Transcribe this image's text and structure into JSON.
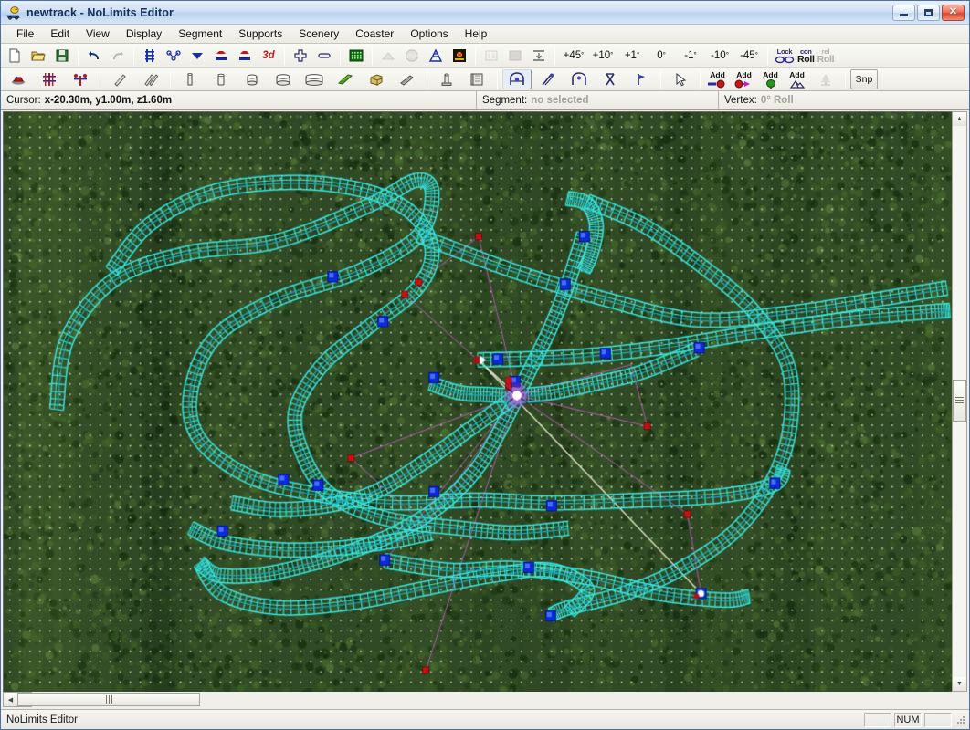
{
  "window": {
    "title": "newtrack - NoLimits Editor",
    "app_icon": "coaster-car-icon",
    "controls": {
      "minimize": "minimize-button",
      "maximize": "maximize-button",
      "close": "close-button"
    }
  },
  "menu": {
    "items": [
      {
        "label": "File"
      },
      {
        "label": "Edit"
      },
      {
        "label": "View"
      },
      {
        "label": "Display"
      },
      {
        "label": "Segment"
      },
      {
        "label": "Supports"
      },
      {
        "label": "Scenery"
      },
      {
        "label": "Coaster"
      },
      {
        "label": "Options"
      },
      {
        "label": "Help"
      }
    ]
  },
  "toolbar_row1": {
    "groups": [
      {
        "buttons": [
          {
            "name": "new-file-button",
            "icon": "new-document-icon",
            "label": ""
          },
          {
            "name": "open-file-button",
            "icon": "open-folder-icon",
            "label": ""
          },
          {
            "name": "save-file-button",
            "icon": "floppy-disk-icon",
            "label": ""
          }
        ]
      },
      {
        "buttons": [
          {
            "name": "undo-button",
            "icon": "undo-arrow-icon",
            "label": ""
          },
          {
            "name": "redo-button",
            "icon": "redo-arrow-icon",
            "label": ""
          }
        ]
      },
      {
        "buttons": [
          {
            "name": "show-track-button",
            "icon": "track-grid-icon",
            "label": ""
          },
          {
            "name": "show-nodes-button",
            "icon": "node-network-icon",
            "label": ""
          },
          {
            "name": "show-vertices-button",
            "icon": "vertex-chevron-icon",
            "label": ""
          },
          {
            "name": "show-train-button",
            "icon": "train-car-icon",
            "label": ""
          },
          {
            "name": "show-train-alt-button",
            "icon": "train-car-alt-icon",
            "label": ""
          },
          {
            "name": "view-3d-button",
            "icon": "3d-text-icon",
            "label": "3d"
          }
        ]
      },
      {
        "buttons": [
          {
            "name": "zoom-in-button",
            "icon": "plus-icon",
            "label": ""
          },
          {
            "name": "zoom-out-button",
            "icon": "minus-icon",
            "label": ""
          }
        ]
      },
      {
        "buttons": [
          {
            "name": "terrain-editor-button",
            "icon": "terrain-grid-icon",
            "label": ""
          }
        ]
      },
      {
        "buttons": [
          {
            "name": "station-button",
            "icon": "ramp-icon",
            "label": "",
            "disabled": true
          },
          {
            "name": "brake-button",
            "icon": "stop-sign-icon",
            "label": "",
            "disabled": true
          },
          {
            "name": "lift-button",
            "icon": "lift-hill-icon",
            "label": ""
          },
          {
            "name": "launch-button",
            "icon": "launch-track-icon",
            "label": ""
          }
        ]
      },
      {
        "buttons": [
          {
            "name": "properties-button",
            "icon": "properties-panel-icon",
            "label": "",
            "disabled": true
          },
          {
            "name": "fill-button",
            "icon": "filled-square-icon",
            "label": "",
            "disabled": true
          },
          {
            "name": "flatten-button",
            "icon": "flatten-icon",
            "label": ""
          }
        ]
      },
      {
        "buttons": [
          {
            "name": "rotate-plus-45-button",
            "icon": "",
            "label": "+45",
            "sup": "°"
          },
          {
            "name": "rotate-plus-10-button",
            "icon": "",
            "label": "+10",
            "sup": "°"
          },
          {
            "name": "rotate-plus-1-button",
            "icon": "",
            "label": "+1",
            "sup": "°"
          },
          {
            "name": "rotate-zero-button",
            "icon": "",
            "label": "0",
            "sup": "°"
          },
          {
            "name": "rotate-minus-1-button",
            "icon": "",
            "label": "-1",
            "sup": "°"
          },
          {
            "name": "rotate-minus-10-button",
            "icon": "",
            "label": "-10",
            "sup": "°"
          },
          {
            "name": "rotate-minus-45-button",
            "icon": "",
            "label": "-45",
            "sup": "°"
          }
        ]
      }
    ],
    "roll_group": {
      "lock_label": "Lock",
      "lock_icon": "chain-link-icon",
      "con_top": "con",
      "con_bottom": "Roll",
      "rel_top": "rel",
      "rel_bottom": "Roll",
      "rel_disabled": true
    }
  },
  "toolbar_row2": {
    "groups": [
      {
        "buttons": [
          {
            "name": "scenery-object-button",
            "icon": "scenery-block-icon"
          },
          {
            "name": "add-support-node-button",
            "icon": "support-node-icon"
          },
          {
            "name": "add-support-beam-button",
            "icon": "support-beam-icon"
          }
        ]
      },
      {
        "buttons": [
          {
            "name": "beam-tool-button",
            "icon": "beam-diagonal-icon"
          },
          {
            "name": "double-beam-tool-button",
            "icon": "double-beam-icon"
          }
        ]
      },
      {
        "buttons": [
          {
            "name": "tube-thin-button",
            "icon": "tube-thin-icon"
          },
          {
            "name": "tube-small-button",
            "icon": "tube-small-icon"
          },
          {
            "name": "cylinder-small-button",
            "icon": "cylinder-small-icon"
          },
          {
            "name": "cylinder-medium-button",
            "icon": "cylinder-medium-icon"
          },
          {
            "name": "cylinder-large-button",
            "icon": "cylinder-large-icon"
          },
          {
            "name": "plate-green-button",
            "icon": "green-plate-icon"
          },
          {
            "name": "box-beam-button",
            "icon": "box-beam-icon"
          },
          {
            "name": "angle-beam-button",
            "icon": "angle-beam-icon"
          }
        ]
      },
      {
        "buttons": [
          {
            "name": "footer-button",
            "icon": "footer-post-icon"
          },
          {
            "name": "flange-button",
            "icon": "flange-plate-icon"
          }
        ]
      },
      {
        "buttons": [
          {
            "name": "support-template-a-button",
            "icon": "support-arch-icon",
            "pressed": true
          },
          {
            "name": "support-template-b-button",
            "icon": "support-angled-icon"
          },
          {
            "name": "support-template-c-button",
            "icon": "support-double-icon"
          },
          {
            "name": "support-template-d-button",
            "icon": "support-x-icon"
          },
          {
            "name": "support-template-e-button",
            "icon": "support-flag-icon"
          }
        ]
      },
      {
        "buttons": [
          {
            "name": "select-tool-button",
            "icon": "cursor-arrow-icon"
          }
        ]
      }
    ],
    "add_buttons": [
      {
        "name": "add-segment-button",
        "label": "Add",
        "icon": "add-red-node-icon"
      },
      {
        "name": "add-vertex-button",
        "label": "Add",
        "icon": "add-magenta-arrow-icon"
      },
      {
        "name": "add-tree-button",
        "label": "Add",
        "icon": "add-green-tree-icon"
      },
      {
        "name": "add-terrain-button",
        "label": "Add",
        "icon": "add-terrain-icon"
      }
    ],
    "tree_button": {
      "name": "place-tree-button",
      "icon": "tree-icon",
      "disabled": true
    },
    "snap_button": {
      "name": "snap-button",
      "label": "Snp"
    }
  },
  "infobar": {
    "cursor_label": "Cursor:",
    "cursor_value": "x-20.30m, y1.00m, z1.60m",
    "segment_label": "Segment:",
    "segment_value": "no selected",
    "vertex_label": "Vertex:",
    "vertex_value": "0° Roll"
  },
  "statusbar": {
    "message": "NoLimits Editor",
    "num_indicator": "NUM",
    "caps_indicator": "",
    "scroll_indicator": ""
  },
  "canvas": {
    "background_color": "#2f4a24",
    "grid_dot_color": "#d8dfc8",
    "grid_spacing": 11,
    "track_color": "#35e4e0",
    "track_color_dark": "#1aa8b8",
    "vertex_color": "#1540e8",
    "vertex_marker_color": "#cc1818",
    "guide_line_color": "#b05ab0",
    "selected_node_color": "#ff66ff",
    "selected_node_core": "#ffffff",
    "white_guide_color": "#e8e8d0"
  },
  "scrollbars": {
    "vertical": {
      "name": "vertical-scrollbar",
      "thumb_position": 0.46
    },
    "horizontal": {
      "name": "horizontal-scrollbar",
      "thumb_position": 0.4
    }
  }
}
